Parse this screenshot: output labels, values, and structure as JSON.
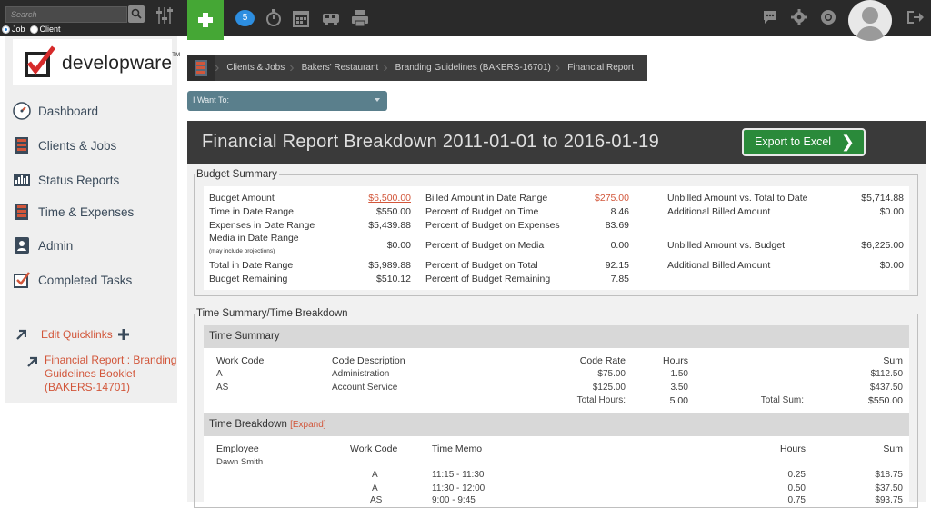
{
  "topbar": {
    "search_placeholder": "Search",
    "radio_job": "Job",
    "radio_client": "Client",
    "notification_count": "5"
  },
  "sidebar": {
    "logo_text": "developware",
    "logo_tm": "TM",
    "items": [
      {
        "label": "Dashboard",
        "icon": "dashboard-icon"
      },
      {
        "label": "Clients & Jobs",
        "icon": "clients-icon"
      },
      {
        "label": "Status Reports",
        "icon": "status-reports-icon"
      },
      {
        "label": "Time & Expenses",
        "icon": "time-expenses-icon"
      },
      {
        "label": "Admin",
        "icon": "admin-icon"
      },
      {
        "label": "Completed Tasks",
        "icon": "completed-tasks-icon"
      }
    ],
    "quicklinks_title": "Edit Quicklinks",
    "quicklink": "Financial Report : Branding Guidelines Booklet (BAKERS-14701)"
  },
  "breadcrumb": [
    "Clients & Jobs",
    "Bakers' Restaurant",
    "Branding Guidelines (BAKERS-16701)",
    "Financial Report"
  ],
  "iwant": "I Want To:",
  "report": {
    "title": "Financial Report Breakdown 2011-01-01 to 2016-01-19",
    "export_label": "Export to Excel"
  },
  "budget": {
    "legend": "Budget Summary",
    "col1": [
      {
        "label": "Budget Amount",
        "value": "$6,500.00"
      },
      {
        "label": "Time in Date Range",
        "value": "$550.00"
      },
      {
        "label": "Expenses in Date Range",
        "value": "$5,439.88"
      },
      {
        "label": "Media in Date Range",
        "note": "(may include projections)",
        "value": "$0.00"
      },
      {
        "label": "Total in Date Range",
        "value": "$5,989.88"
      },
      {
        "label": "Budget Remaining",
        "value": "$510.12"
      }
    ],
    "col2": [
      {
        "label": "Billed Amount in Date Range",
        "value": "$275.00"
      },
      {
        "label": "Percent of Budget on Time",
        "value": "8.46"
      },
      {
        "label": "Percent of Budget on Expenses",
        "value": "83.69"
      },
      {
        "label": "Percent of Budget on Media",
        "value": "0.00"
      },
      {
        "label": "Percent of Budget on Total",
        "value": "92.15"
      },
      {
        "label": "Percent of Budget Remaining",
        "value": "7.85"
      }
    ],
    "col3": [
      {
        "label": "Unbilled Amount vs. Total to Date",
        "value": "$5,714.88"
      },
      {
        "label": "Additional Billed Amount",
        "value": "$0.00"
      },
      {
        "label": "Unbilled Amount vs. Budget",
        "value": "$6,225.00"
      },
      {
        "label": "Additional Billed Amount",
        "value": "$0.00"
      }
    ]
  },
  "time": {
    "legend": "Time Summary/Time Breakdown",
    "summary_title": "Time Summary",
    "headers": [
      "Work Code",
      "Code Description",
      "Code Rate",
      "Hours",
      "Sum"
    ],
    "rows": [
      [
        "A",
        "Administration",
        "$75.00",
        "1.50",
        "$112.50"
      ],
      [
        "AS",
        "Account Service",
        "$125.00",
        "3.50",
        "$437.50"
      ]
    ],
    "total_hours_label": "Total Hours:",
    "total_hours": "5.00",
    "total_sum_label": "Total Sum:",
    "total_sum": "$550.00",
    "breakdown_title": "Time Breakdown",
    "expand_label": "[Expand]",
    "breakdown_headers": [
      "Employee",
      "Work Code",
      "Time Memo",
      "Hours",
      "Sum"
    ],
    "employee": "Dawn Smith",
    "breakdown_rows": [
      [
        "A",
        "11:15 - 11:30",
        "0.25",
        "$18.75"
      ],
      [
        "A",
        "11:30 - 12:00",
        "0.50",
        "$37.50"
      ],
      [
        "AS",
        "9:00 - 9:45",
        "0.75",
        "$93.75"
      ]
    ]
  }
}
